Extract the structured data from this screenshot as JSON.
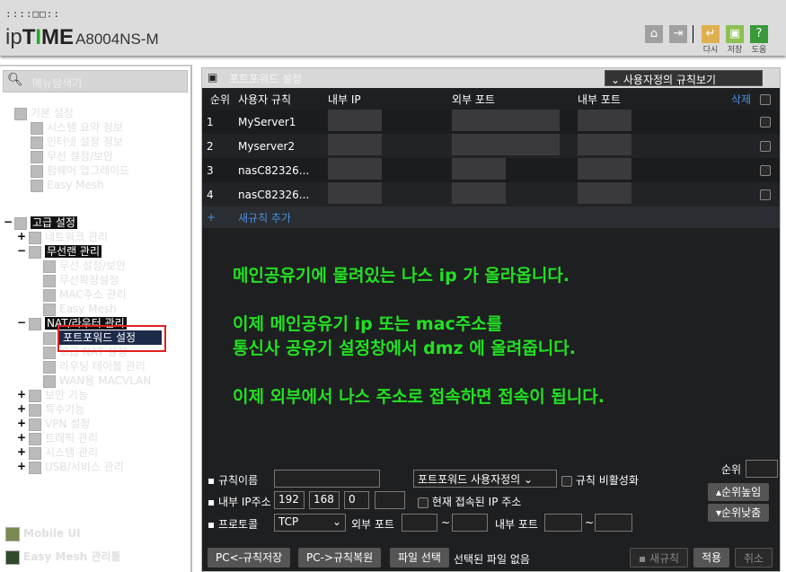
{
  "header": {
    "brand_prefix": "ip",
    "brand_t": "T",
    "brand_i": "I",
    "brand_me": "ME",
    "model": "A8004NS-M",
    "dots": "::::□□::",
    "buttons": [
      {
        "label": "",
        "icon": "home-icon"
      },
      {
        "label": "",
        "icon": "logout-icon"
      },
      {
        "label": "다시",
        "icon": "restart-icon"
      },
      {
        "label": "저장",
        "icon": "save-icon"
      },
      {
        "label": "도움",
        "icon": "help-icon"
      }
    ]
  },
  "sidebar": {
    "search": "메뉴탐색기",
    "basic": {
      "label": "기본 설정",
      "items": [
        "시스템 요약 정보",
        "인터넷 설정 정보",
        "무선 설정/보안",
        "펌웨어 업그레이드",
        "Easy Mesh"
      ]
    },
    "advanced": {
      "label": "고급 설정",
      "network": "네트워크 관리",
      "wireless": "무선랜 관리",
      "wireless_items": [
        "무선 설정/보안",
        "무선확장설정",
        "MAC주소 관리",
        "Easy Mesh"
      ],
      "nat": "NAT/라우터 관리",
      "nat_items": [
        "포트포워드 설정",
        "고급 NAT 설정",
        "라우팅 테이블 관리",
        "WAN용 MACVLAN"
      ],
      "others": [
        "보안 기능",
        "특수기능",
        "VPN 설정",
        "트래픽 관리",
        "시스템 관리",
        "USB/서비스 관리"
      ]
    },
    "mobile": "Mobile UI",
    "mesh_tool": "Easy Mesh 관리툴"
  },
  "main": {
    "title": "포트포워드 설정",
    "view_select": "사용자정의 규칙보기",
    "columns": [
      "순위",
      "사용자 규칙",
      "내부 IP",
      "외부 포트",
      "내부 포트",
      "삭제"
    ],
    "rows": [
      {
        "n": "1",
        "name": "MyServer1"
      },
      {
        "n": "2",
        "name": "Myserver2"
      },
      {
        "n": "3",
        "name": "nasC82326..."
      },
      {
        "n": "4",
        "name": "nasC82326..."
      }
    ],
    "add_rule": "새규칙 추가",
    "messages": [
      "메인공유기에 물려있는 나스 ip 가 올라옵니다.",
      "이제 메인공유기 ip 또는 mac주소를",
      "통신사 공유기 설정창에서 dmz 에 올려줍니다.",
      "이제 외부에서 나스 주소로 접속하면 접속이 됩니다."
    ],
    "form": {
      "rule_name_label": "규칙이름",
      "rule_name": "",
      "type_select": "포트포워드 사용자정의",
      "disable_label": "규칙 비활성화",
      "ip_label": "내부 IP주소",
      "ip": [
        "192",
        "168",
        "0",
        ""
      ],
      "current_ip_label": "현재 접속된 IP 주소",
      "protocol_label": "프로토콜",
      "protocol": "TCP",
      "ext_port_label": "외부 포트",
      "int_port_label": "내부 포트",
      "tilde": "~",
      "order_label": "순위",
      "order_up": "순위높임",
      "order_down": "순위낮춤",
      "save_pc": "PC<-규칙저장",
      "restore_pc": "PC->규칙복원",
      "file_select": "파일 선택",
      "no_file": "선택된 파일 없음",
      "new_rule": "새규칙",
      "apply": "적용",
      "cancel": "취소"
    }
  }
}
